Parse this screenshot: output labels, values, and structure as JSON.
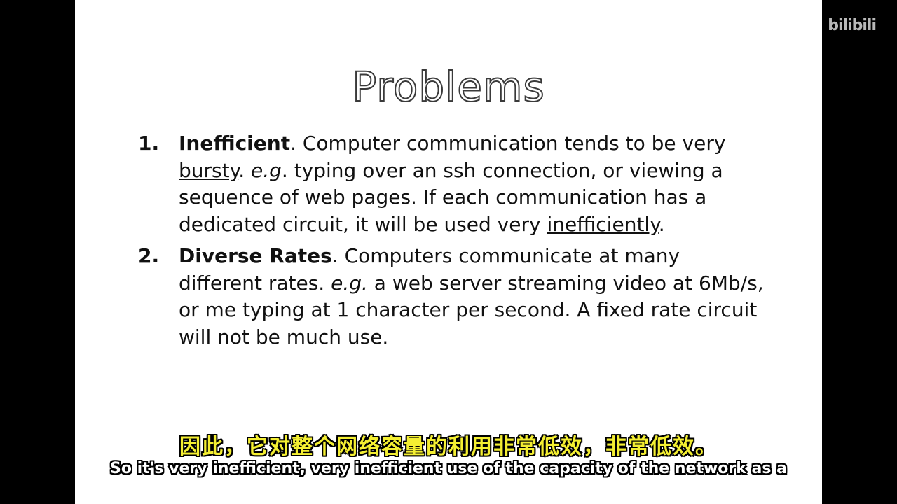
{
  "slide": {
    "title": "Problems",
    "items": [
      {
        "number": "1.",
        "term": "Inefficient",
        "t1": ". Computer communication tends to be very ",
        "u1": "bursty",
        "t2": ". ",
        "i1": "e.g",
        "t3": ". typing over an ssh connection, or viewing a sequence of web pages. If each communication has a dedicated circuit, it will be used very ",
        "u2": "inefficiently",
        "t4": "."
      },
      {
        "number": "2.",
        "term": "Diverse Rates",
        "t1": ". Computers communicate at many different rates.  ",
        "i1": "e.g.",
        "t2": " a web server streaming video at 6Mb/s, or me typing at 1 character per second. A fixed rate circuit will not be much use."
      }
    ]
  },
  "watermark": "bilibili",
  "subtitles": {
    "chinese": "因此，它对整个网络容量的利用非常低效，非常低效。",
    "english": "So it's very inefficient, very inefficient use of the capacity of the network as a"
  }
}
